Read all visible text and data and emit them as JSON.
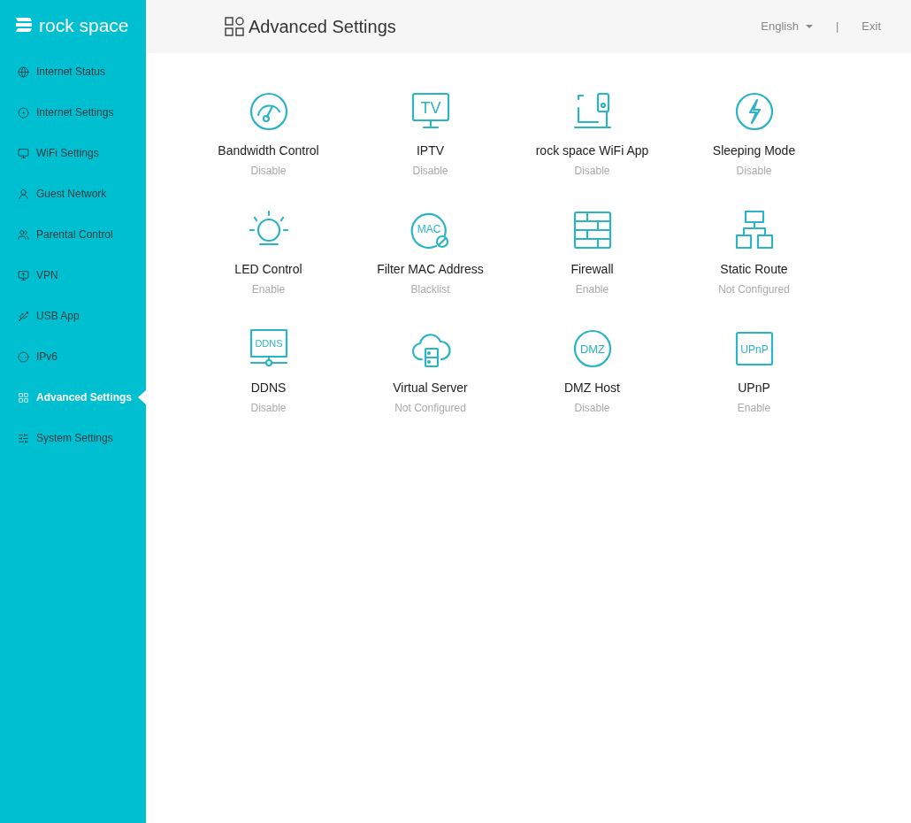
{
  "logo": {
    "text": "rock space"
  },
  "sidebar": {
    "items": [
      {
        "label": "Internet Status",
        "selected": false
      },
      {
        "label": "Internet Settings",
        "selected": false
      },
      {
        "label": "WiFi Settings",
        "selected": false
      },
      {
        "label": "Guest Network",
        "selected": false
      },
      {
        "label": "Parental Control",
        "selected": false
      },
      {
        "label": "VPN",
        "selected": false
      },
      {
        "label": "USB App",
        "selected": false
      },
      {
        "label": "IPv6",
        "selected": false
      },
      {
        "label": "Advanced Settings",
        "selected": true
      },
      {
        "label": "System Settings",
        "selected": false
      }
    ]
  },
  "header": {
    "title": "Advanced Settings",
    "language": "English",
    "separator": "|",
    "exit": "Exit"
  },
  "tiles": [
    {
      "label": "Bandwidth Control",
      "status": "Disable"
    },
    {
      "label": "IPTV",
      "status": "Disable",
      "icon_text": "TV"
    },
    {
      "label": "rock space WiFi App",
      "status": "Disable"
    },
    {
      "label": "Sleeping Mode",
      "status": "Disable"
    },
    {
      "label": "LED Control",
      "status": "Enable"
    },
    {
      "label": "Filter MAC Address",
      "status": "Blacklist",
      "icon_text": "MAC"
    },
    {
      "label": "Firewall",
      "status": "Enable"
    },
    {
      "label": "Static Route",
      "status": "Not Configured"
    },
    {
      "label": "DDNS",
      "status": "Disable",
      "icon_text": "DDNS"
    },
    {
      "label": "Virtual Server",
      "status": "Not Configured"
    },
    {
      "label": "DMZ Host",
      "status": "Disable",
      "icon_text": "DMZ"
    },
    {
      "label": "UPnP",
      "status": "Enable",
      "icon_text": "UPnP"
    }
  ]
}
